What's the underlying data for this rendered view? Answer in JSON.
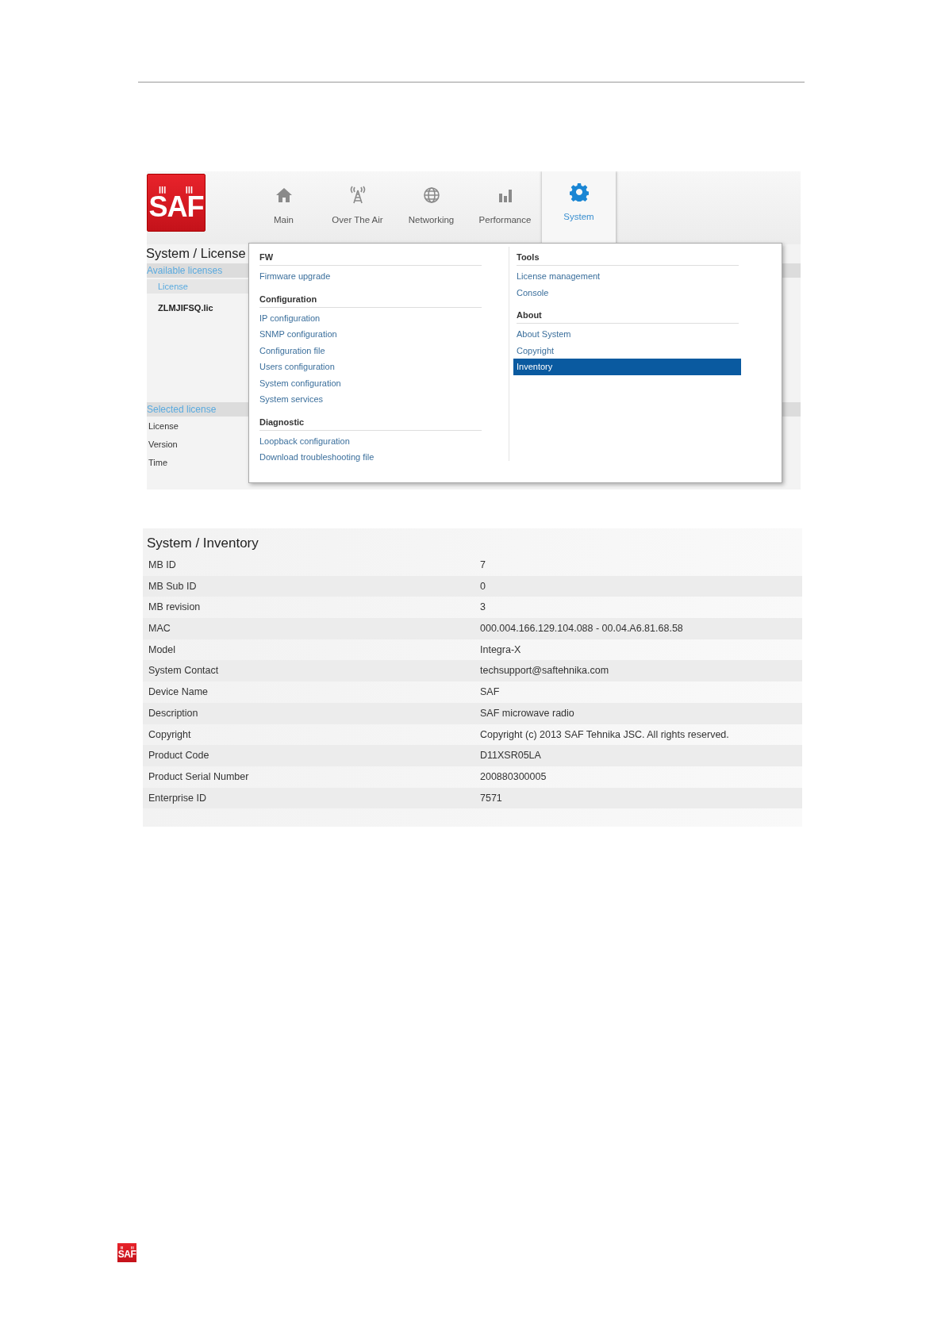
{
  "license_screen": {
    "logo": "SAF",
    "nav": [
      {
        "label": "Main",
        "selected": false
      },
      {
        "label": "Over The Air",
        "selected": false
      },
      {
        "label": "Networking",
        "selected": false
      },
      {
        "label": "Performance",
        "selected": false
      },
      {
        "label": "System",
        "selected": true
      }
    ],
    "page_title": "System / License",
    "available_header": "Available licenses",
    "license_column": "License",
    "license_file": "ZLMJIFSQ.lic",
    "selected_header": "Selected license",
    "selected_fields": [
      "License",
      "Version",
      "Time"
    ],
    "menu": {
      "columns": [
        {
          "sections": [
            {
              "title": "FW",
              "items": [
                {
                  "label": "Firmware upgrade",
                  "selected": false
                }
              ]
            },
            {
              "title": "Configuration",
              "items": [
                {
                  "label": "IP configuration",
                  "selected": false
                },
                {
                  "label": "SNMP configuration",
                  "selected": false
                },
                {
                  "label": "Configuration file",
                  "selected": false
                },
                {
                  "label": "Users configuration",
                  "selected": false
                },
                {
                  "label": "System configuration",
                  "selected": false
                },
                {
                  "label": "System services",
                  "selected": false
                }
              ]
            },
            {
              "title": "Diagnostic",
              "items": [
                {
                  "label": "Loopback configuration",
                  "selected": false
                },
                {
                  "label": "Download troubleshooting file",
                  "selected": false
                }
              ]
            }
          ]
        },
        {
          "sections": [
            {
              "title": "Tools",
              "items": [
                {
                  "label": "License management",
                  "selected": false
                },
                {
                  "label": "Console",
                  "selected": false
                }
              ]
            },
            {
              "title": "About",
              "items": [
                {
                  "label": "About System",
                  "selected": false
                },
                {
                  "label": "Copyright",
                  "selected": false
                },
                {
                  "label": "Inventory",
                  "selected": true
                }
              ]
            }
          ]
        }
      ]
    }
  },
  "inventory_screen": {
    "title": "System / Inventory",
    "rows": [
      {
        "label": "MB ID",
        "value": "7"
      },
      {
        "label": "MB Sub ID",
        "value": "0"
      },
      {
        "label": "MB revision",
        "value": "3"
      },
      {
        "label": "MAC",
        "value": "000.004.166.129.104.088 - 00.04.A6.81.68.58"
      },
      {
        "label": "Model",
        "value": "Integra-X"
      },
      {
        "label": "System Contact",
        "value": "techsupport@saftehnika.com"
      },
      {
        "label": "Device Name",
        "value": "SAF"
      },
      {
        "label": "Description",
        "value": "SAF microwave radio"
      },
      {
        "label": "Copyright",
        "value": "Copyright (c) 2013 SAF Tehnika JSC. All rights reserved."
      },
      {
        "label": "Product Code",
        "value": "D11XSR05LA"
      },
      {
        "label": "Product Serial Number",
        "value": "200880300005"
      },
      {
        "label": "Enterprise ID",
        "value": "7571"
      }
    ]
  },
  "footer_logo": "SAF"
}
